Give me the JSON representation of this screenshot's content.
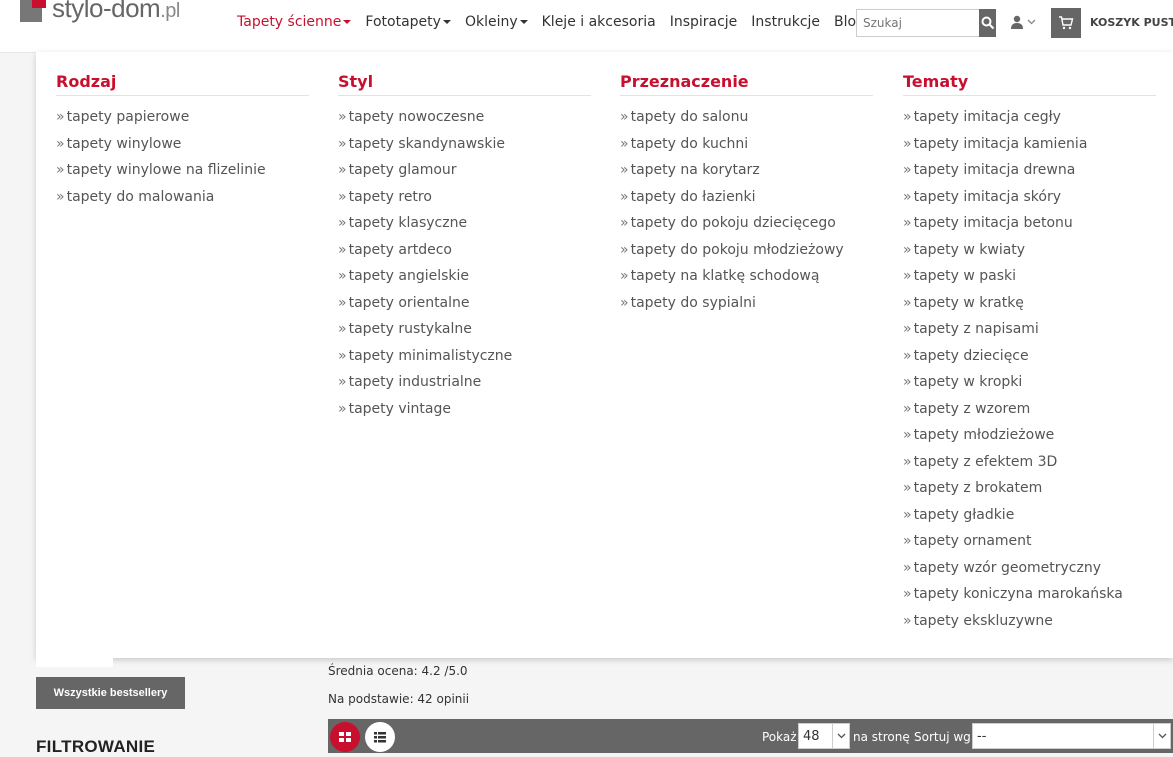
{
  "header": {
    "logo_text": "stylo-dom",
    "logo_suffix": ".pl",
    "nav": [
      {
        "label": "Tapety ścienne",
        "dropdown": true,
        "active": true
      },
      {
        "label": "Fototapety",
        "dropdown": true
      },
      {
        "label": "Okleiny",
        "dropdown": true
      },
      {
        "label": "Kleje i akcesoria",
        "dropdown": false
      },
      {
        "label": "Inspiracje",
        "dropdown": false
      },
      {
        "label": "Instrukcje",
        "dropdown": false
      },
      {
        "label": "Blog",
        "dropdown": false
      }
    ],
    "search_placeholder": "Szukaj",
    "cart_label": "KOSZYK PUSTY"
  },
  "menu": {
    "columns": [
      {
        "heading": "Rodzaj",
        "items": [
          "tapety papierowe",
          "tapety winylowe",
          "tapety winylowe na flizelinie",
          "tapety do malowania"
        ]
      },
      {
        "heading": "Styl",
        "items": [
          "tapety nowoczesne",
          "tapety skandynawskie",
          "tapety glamour",
          "tapety retro",
          "tapety klasyczne",
          "tapety artdeco",
          "tapety angielskie",
          "tapety orientalne",
          "tapety rustykalne",
          "tapety minimalistyczne",
          "tapety industrialne",
          "tapety vintage"
        ]
      },
      {
        "heading": "Przeznaczenie",
        "items": [
          "tapety do salonu",
          "tapety do kuchni",
          "tapety na korytarz",
          "tapety do łazienki",
          "tapety do pokoju dziecięcego",
          "tapety do pokoju młodzieżowy",
          "tapety na klatkę schodową",
          "tapety do sypialni"
        ]
      },
      {
        "heading": "Tematy",
        "items": [
          "tapety imitacja cegły",
          "tapety imitacja kamienia",
          "tapety imitacja drewna",
          "tapety imitacja skóry",
          "tapety imitacja betonu",
          "tapety w kwiaty",
          "tapety w paski",
          "tapety w kratkę",
          "tapety z napisami",
          "tapety dziecięce",
          "tapety w kropki",
          "tapety z wzorem",
          "tapety młodzieżowe",
          "tapety z efektem 3D",
          "tapety z brokatem",
          "tapety gładkie",
          "tapety ornament",
          "tapety wzór geometryczny",
          "tapety koniczyna marokańska",
          "tapety ekskluzywne"
        ]
      }
    ]
  },
  "sidebar": {
    "bestsellers_button": "Wszystkie bestsellery",
    "filter_title": "FILTROWANIE"
  },
  "content": {
    "rating_text": "Średnia ocena: 4.2 /5.0",
    "reviews_text": "Na podstawie: 42 opinii"
  },
  "toolbar": {
    "show_label": "Pokaż",
    "per_page_value": "48",
    "per_page_suffix": "na stronę",
    "sort_label": "Sortuj wg",
    "sort_value": "--"
  },
  "colors": {
    "accent": "#c8102e",
    "dark_gray": "#666666"
  }
}
